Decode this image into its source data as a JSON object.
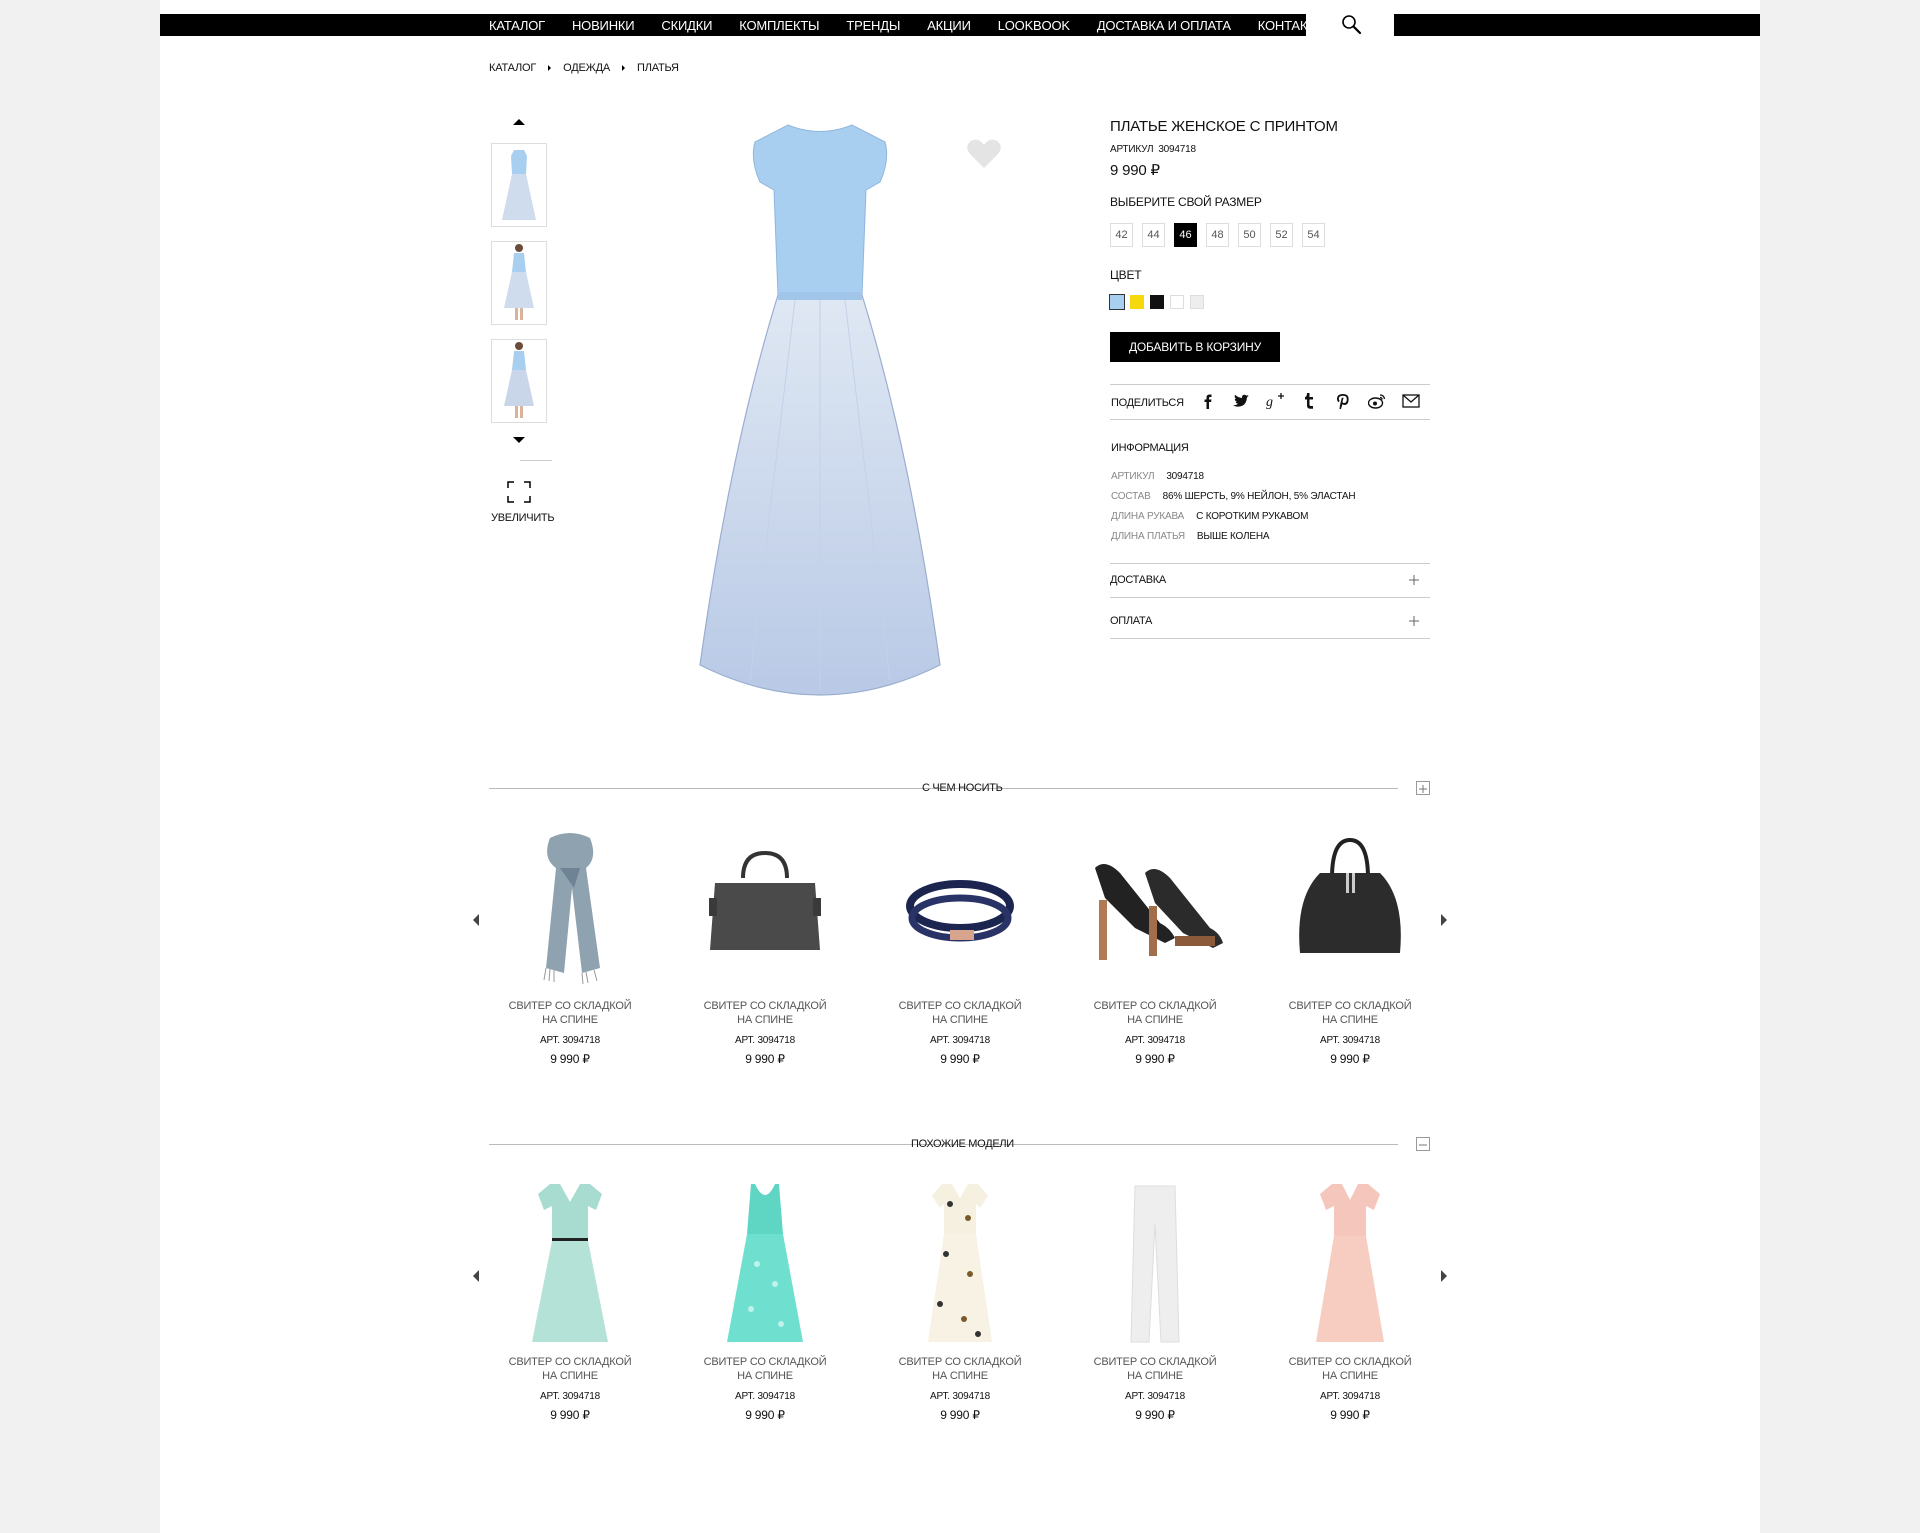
{
  "nav": {
    "items": [
      "КАТАЛОГ",
      "НОВИНКИ",
      "СКИДКИ",
      "КОМПЛЕКТЫ",
      "ТРЕНДЫ",
      "АКЦИИ",
      "LOOKBOOK",
      "ДОСТАВКА И ОПЛАТА",
      "КОНТАКТЫ"
    ]
  },
  "breadcrumb": [
    "КАТАЛОГ",
    "ОДЕЖДА",
    "ПЛАТЬЯ"
  ],
  "gallery": {
    "zoom_label": "УВЕЛИЧИТЬ"
  },
  "product": {
    "title": "ПЛАТЬЕ ЖЕНСКОЕ С ПРИНТОМ",
    "sku_label": "АРТИКУЛ",
    "sku": "3094718",
    "price": "9 990 ₽",
    "size_label": "ВЫБЕРИТЕ СВОЙ РАЗМЕР",
    "sizes": [
      "42",
      "44",
      "46",
      "48",
      "50",
      "52",
      "54"
    ],
    "selected_size": "46",
    "color_label": "ЦВЕТ",
    "colors": [
      "#a9cff0",
      "#f5d90c",
      "#111111",
      "#ffffff",
      "#eeeeee"
    ],
    "add_to_cart": "ДОБАВИТЬ В КОРЗИНУ",
    "share_label": "ПОДЕЛИТЬСЯ",
    "share_icons": [
      "facebook-icon",
      "twitter-icon",
      "google-plus-icon",
      "tumblr-icon",
      "pinterest-icon",
      "weibo-icon",
      "mail-icon"
    ],
    "info_title": "ИНФОРМАЦИЯ",
    "attributes": [
      {
        "key": "АРТИКУЛ",
        "value": "3094718"
      },
      {
        "key": "СОСТАВ",
        "value": "86% ШЕРСТЬ, 9% НЕЙЛОН, 5% ЭЛАСТАН"
      },
      {
        "key": "ДЛИНА РУКАВА",
        "value": "С КОРОТКИМ РУКАВОМ"
      },
      {
        "key": "ДЛИНА ПЛАТЬЯ",
        "value": "ВЫШЕ КОЛЕНА"
      }
    ],
    "delivery_label": "ДОСТАВКА",
    "payment_label": "ОПЛАТА"
  },
  "wear_with": {
    "title": "С ЧЕМ НОСИТЬ",
    "items": [
      {
        "name1": "СВИТЕР СО СКЛАДКОЙ",
        "name2": "НА СПИНЕ",
        "sku": "АРТ. 3094718",
        "price": "9 990 ₽",
        "icon": "scarf-icon"
      },
      {
        "name1": "СВИТЕР СО СКЛАДКОЙ",
        "name2": "НА СПИНЕ",
        "sku": "АРТ. 3094718",
        "price": "9 990 ₽",
        "icon": "handbag-icon"
      },
      {
        "name1": "СВИТЕР СО СКЛАДКОЙ",
        "name2": "НА СПИНЕ",
        "sku": "АРТ. 3094718",
        "price": "9 990 ₽",
        "icon": "belt-icon"
      },
      {
        "name1": "СВИТЕР СО СКЛАДКОЙ",
        "name2": "НА СПИНЕ",
        "sku": "АРТ. 3094718",
        "price": "9 990 ₽",
        "icon": "shoes-icon"
      },
      {
        "name1": "СВИТЕР СО СКЛАДКОЙ",
        "name2": "НА СПИНЕ",
        "sku": "АРТ. 3094718",
        "price": "9 990 ₽",
        "icon": "bag-icon"
      }
    ]
  },
  "similar": {
    "title": "ПОХОЖИЕ МОДЕЛИ",
    "items": [
      {
        "name1": "СВИТЕР СО СКЛАДКОЙ",
        "name2": "НА СПИНЕ",
        "sku": "АРТ. 3094718",
        "price": "9 990 ₽",
        "icon": "mint-dress-icon"
      },
      {
        "name1": "СВИТЕР СО СКЛАДКОЙ",
        "name2": "НА СПИНЕ",
        "sku": "АРТ. 3094718",
        "price": "9 990 ₽",
        "icon": "turquoise-dress-icon"
      },
      {
        "name1": "СВИТЕР СО СКЛАДКОЙ",
        "name2": "НА СПИНЕ",
        "sku": "АРТ. 3094718",
        "price": "9 990 ₽",
        "icon": "floral-dress-icon"
      },
      {
        "name1": "СВИТЕР СО СКЛАДКОЙ",
        "name2": "НА СПИНЕ",
        "sku": "АРТ. 3094718",
        "price": "9 990 ₽",
        "icon": "white-trousers-icon"
      },
      {
        "name1": "СВИТЕР СО СКЛАДКОЙ",
        "name2": "НА СПИНЕ",
        "sku": "АРТ. 3094718",
        "price": "9 990 ₽",
        "icon": "pink-dress-icon"
      }
    ]
  }
}
